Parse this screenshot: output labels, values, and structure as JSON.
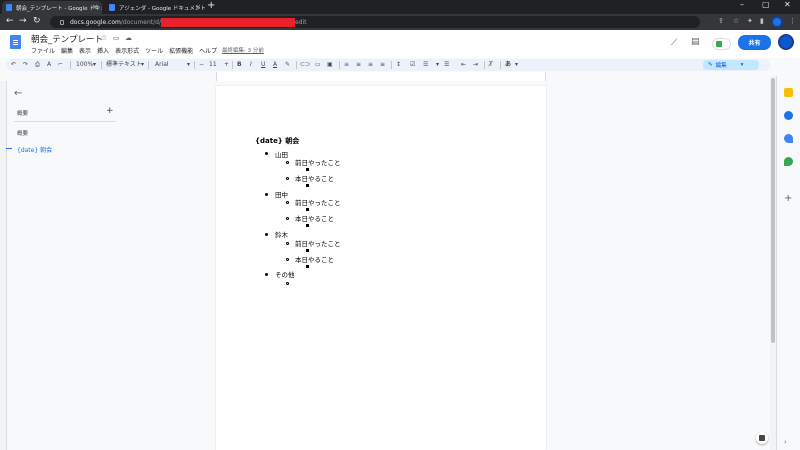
{
  "browser": {
    "tabs": [
      {
        "label": "朝会_テンプレート - Google ドキュメ"
      },
      {
        "label": "アジェンダ - Google ドキュメント"
      }
    ],
    "close_glyph": "×",
    "new_tab_glyph": "+",
    "url_host": "docs.google.com",
    "url_path": "/document/d/",
    "url_suffix": "edit"
  },
  "docs": {
    "title": "朝会_テンプレート",
    "menu": [
      "ファイル",
      "編集",
      "表示",
      "挿入",
      "表示形式",
      "ツール",
      "拡張機能",
      "ヘルプ"
    ],
    "last_edit": "最終編集: 3 分前",
    "share_label": "共有"
  },
  "format_toolbar": {
    "zoom": "100%",
    "style": "標準テキスト",
    "font": "Arial",
    "font_size": "11",
    "mode": "編集"
  },
  "outline": {
    "title": "概要",
    "subtitle": "概要",
    "items": [
      "{date} 朝会"
    ]
  },
  "document": {
    "heading": "{date} 朝会",
    "people": [
      {
        "name": "山田",
        "items": [
          "前日やったこと",
          "本日やること"
        ]
      },
      {
        "name": "田中",
        "items": [
          "前日やったこと",
          "本日やること"
        ]
      },
      {
        "name": "鈴木",
        "items": [
          "前日やったこと",
          "本日やること"
        ]
      }
    ],
    "other": "その他"
  },
  "colors": {
    "accent": "#1a73e8",
    "tab_bg": "#202124",
    "redaction": "#e8212a"
  }
}
